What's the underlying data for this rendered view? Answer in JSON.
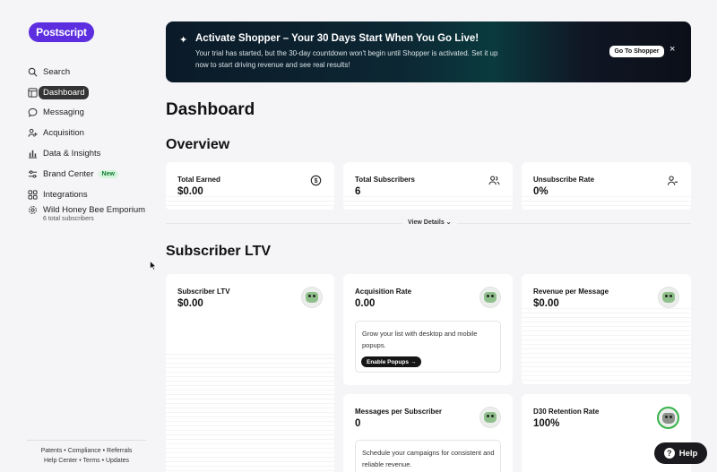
{
  "brand": {
    "logo_text": "Postscript",
    "accent": "#5c2ee0"
  },
  "sidebar": {
    "items": [
      {
        "label": "Search",
        "icon": "search-icon"
      },
      {
        "label": "Dashboard",
        "icon": "layout-icon",
        "active": true
      },
      {
        "label": "Messaging",
        "icon": "chat-icon"
      },
      {
        "label": "Acquisition",
        "icon": "user-plus-icon"
      },
      {
        "label": "Data & Insights",
        "icon": "bar-chart-icon"
      },
      {
        "label": "Brand Center",
        "icon": "sliders-icon",
        "badge": "New"
      },
      {
        "label": "Integrations",
        "icon": "grid-icon"
      }
    ],
    "org": {
      "name": "Wild Honey Bee Emporium",
      "subtitle": "6 total subscribers",
      "icon": "gear-icon"
    },
    "footer": {
      "links": [
        "Patents",
        "Compliance",
        "Referrals",
        "Help Center",
        "Terms",
        "Updates"
      ],
      "separator": "•"
    }
  },
  "banner": {
    "title": "Activate Shopper – Your 30 Days Start When You Go Live!",
    "description": "Your trial has started, but the 30-day countdown won't begin until Shopper is activated. Set it up now to start driving revenue and see real results!",
    "button_label": "Go To Shopper",
    "close": "×",
    "spark": "✦"
  },
  "page": {
    "title": "Dashboard"
  },
  "overview": {
    "heading": "Overview",
    "cards": [
      {
        "title": "Total Earned",
        "value": "$0.00",
        "icon": "dollar-circle-icon"
      },
      {
        "title": "Total Subscribers",
        "value": "6",
        "icon": "users-icon"
      },
      {
        "title": "Unsubscribe Rate",
        "value": "0%",
        "icon": "user-minus-icon"
      }
    ],
    "view_details": "View Details ⌄"
  },
  "ltv": {
    "heading": "Subscriber LTV",
    "cards": [
      {
        "title": "Subscriber LTV",
        "value": "$0.00"
      },
      {
        "title": "Acquisition Rate",
        "value": "0.00",
        "tip": "Grow your list with desktop and mobile popups.",
        "tip_button": "Enable Popups →"
      },
      {
        "title": "Revenue per Message",
        "value": "$0.00"
      },
      {
        "title": "Messages per Subscriber",
        "value": "0",
        "tip": "Schedule your campaigns for consistent and reliable revenue."
      },
      {
        "title": "D30 Retention Rate",
        "value": "100%"
      }
    ]
  },
  "help": {
    "label": "Help",
    "icon": "question-icon"
  }
}
